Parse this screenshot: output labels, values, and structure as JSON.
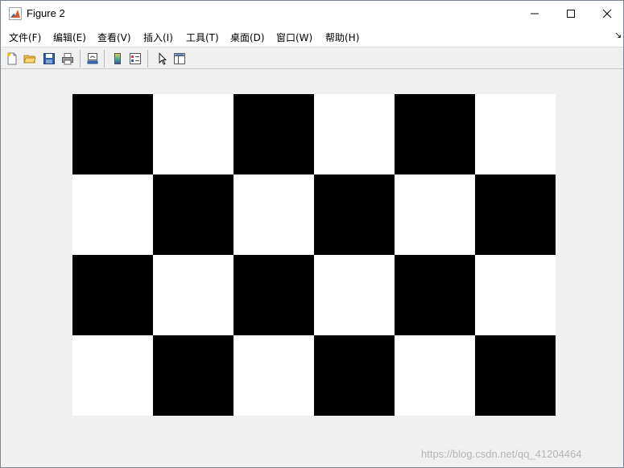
{
  "window": {
    "title": "Figure 2",
    "icon": "matlab-figure-icon"
  },
  "menu": {
    "items": [
      "文件(F)",
      "编辑(E)",
      "查看(V)",
      "插入(I)",
      "工具(T)",
      "桌面(D)",
      "窗口(W)",
      "帮助(H)"
    ],
    "overflow_glyph": "↘"
  },
  "toolbar": {
    "buttons": [
      "new-figure-icon",
      "open-file-icon",
      "save-icon",
      "print-icon",
      "link-plot-icon",
      "colorbar-icon",
      "legend-icon",
      "edit-plot-arrow-icon",
      "property-inspector-icon"
    ]
  },
  "figure": {
    "checkerboard": {
      "rows": 4,
      "cols": 6,
      "pattern": [
        [
          0,
          1,
          0,
          1,
          0,
          1
        ],
        [
          1,
          0,
          1,
          0,
          1,
          0
        ],
        [
          0,
          1,
          0,
          1,
          0,
          1
        ],
        [
          1,
          0,
          1,
          0,
          1,
          0
        ]
      ],
      "colors": {
        "0": "#000000",
        "1": "#ffffff"
      }
    }
  },
  "watermark": "https://blog.csdn.net/qq_41204464",
  "colors": {
    "window_bg": "#f0f0f0",
    "titlebar_bg": "#ffffff"
  }
}
